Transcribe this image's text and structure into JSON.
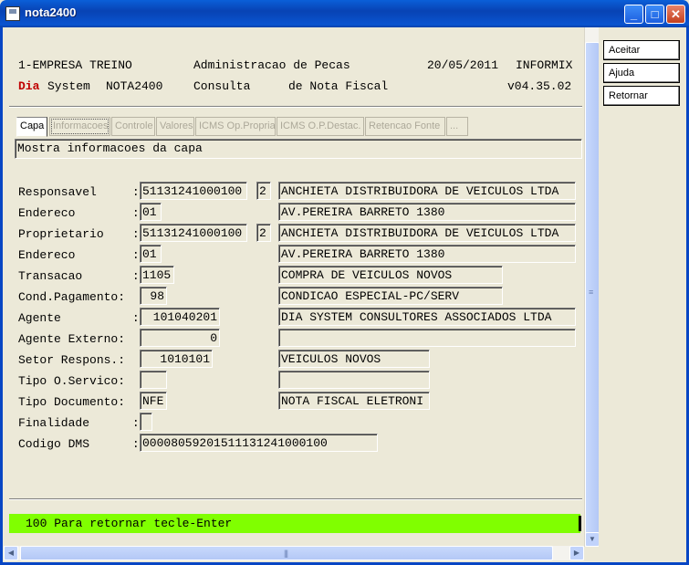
{
  "window": {
    "title": "nota2400",
    "minimize": "_",
    "maximize": "□",
    "close": "✕"
  },
  "header": {
    "line1_left": "1-EMPRESA TREINO",
    "line1_mid": "Administracao de Pecas",
    "line1_date": "20/05/2011",
    "line1_right": "INFORMIX",
    "line2_dia": "Dia",
    "line2_system": "System",
    "line2_prog": "NOTA2400",
    "line2_mid1": "Consulta",
    "line2_mid2": "de Nota Fiscal",
    "line2_version": "v04.35.02"
  },
  "tabs": [
    "Capa",
    "Informacoes",
    "Controle",
    "Valores",
    "ICMS Op.Propria",
    "ICMS O.P.Destac.",
    "Retencao Fonte",
    "..."
  ],
  "message": "Mostra informacoes da capa",
  "form": {
    "responsavel_label": "Responsavel     :",
    "responsavel_code": "51131241000100",
    "responsavel_seq": "2",
    "responsavel_name": "ANCHIETA DISTRIBUIDORA DE VEICULOS LTDA",
    "endereco1_label": "Endereco        :",
    "endereco1_code": "01",
    "endereco1_desc": "AV.PEREIRA BARRETO 1380",
    "proprietario_label": "Proprietario    :",
    "proprietario_code": "51131241000100",
    "proprietario_seq": "2",
    "proprietario_name": "ANCHIETA DISTRIBUIDORA DE VEICULOS LTDA",
    "endereco2_label": "Endereco        :",
    "endereco2_code": "01",
    "endereco2_desc": "AV.PEREIRA BARRETO 1380",
    "transacao_label": "Transacao       :",
    "transacao_code": "1105",
    "transacao_desc": "COMPRA DE VEICULOS NOVOS",
    "condpag_label": "Cond.Pagamento:",
    "condpag_code": "98",
    "condpag_desc": "CONDICAO ESPECIAL-PC/SERV",
    "agente_label": "Agente          :",
    "agente_code": "101040201",
    "agente_desc": "DIA SYSTEM CONSULTORES ASSOCIADOS LTDA",
    "agente_ext_label": "Agente Externo:",
    "agente_ext_code": "0",
    "agente_ext_desc": "",
    "setor_label": "Setor Respons.:",
    "setor_code": "1010101",
    "setor_desc": "VEICULOS NOVOS",
    "tipo_os_label": "Tipo O.Servico:",
    "tipo_os_code": "",
    "tipo_os_desc": "",
    "tipo_doc_label": "Tipo Documento:",
    "tipo_doc_code": "NFE",
    "tipo_doc_desc": "NOTA FISCAL ELETRONI",
    "finalidade_label": "Finalidade      :",
    "finalidade_code": "",
    "codigo_dms_label": "Codigo DMS      :",
    "codigo_dms_value": "00008059201511131241000100"
  },
  "status": "100 Para retornar tecle-Enter",
  "buttons": {
    "aceitar": "Aceitar",
    "ajuda": "Ajuda",
    "retornar": "Retornar"
  },
  "colors": {
    "status_bg": "#80ff00",
    "dia_red": "#c00000",
    "titlebar_blue": "#0a54d0"
  }
}
